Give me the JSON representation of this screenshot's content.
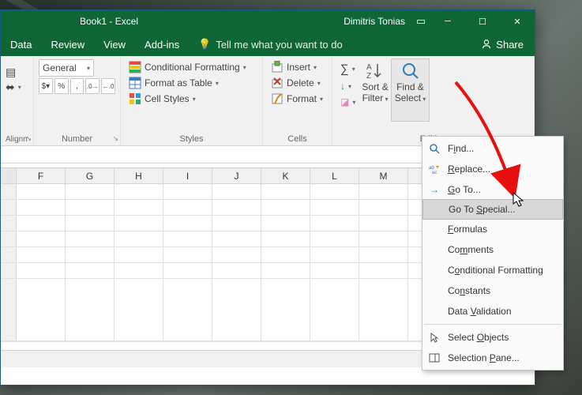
{
  "title_app": "Book1 - Excel",
  "title_user": "Dimitris Tonias",
  "menu": {
    "data": "Data",
    "review": "Review",
    "view": "View",
    "addins": "Add-ins",
    "tell": "Tell me what you want to do",
    "share": "Share"
  },
  "number": {
    "group": "Number",
    "format": "General"
  },
  "styles": {
    "group": "Styles",
    "cf": "Conditional Formatting",
    "table": "Format as Table",
    "cell": "Cell Styles"
  },
  "cells": {
    "group": "Cells",
    "insert": "Insert",
    "delete": "Delete",
    "format": "Format"
  },
  "editing": {
    "group": "Editing",
    "sort": "Sort & Filter",
    "find": "Find & Select"
  },
  "align_group": "Alignment",
  "cols": [
    "F",
    "G",
    "H",
    "I",
    "J",
    "K",
    "L",
    "M"
  ],
  "menu_items": {
    "find_pre": "F",
    "find_u": "i",
    "find_post": "nd...",
    "replace_u": "R",
    "replace_post": "eplace...",
    "goto_pre": "",
    "goto_u": "G",
    "goto_post": "o To...",
    "special_pre": "Go To ",
    "special_u": "S",
    "special_post": "pecial...",
    "formulas_u": "F",
    "formulas_post": "ormulas",
    "comments_pre": "Co",
    "comments_u": "m",
    "comments_post": "ments",
    "cf_pre": "C",
    "cf_u": "o",
    "cf_post": "nditional Formatting",
    "const_pre": "Co",
    "const_u": "n",
    "const_post": "stants",
    "dv_pre": "Data ",
    "dv_u": "V",
    "dv_post": "alidation",
    "obj_pre": "Select ",
    "obj_u": "O",
    "obj_post": "bjects",
    "pane_pre": "Selection ",
    "pane_u": "P",
    "pane_post": "ane..."
  }
}
